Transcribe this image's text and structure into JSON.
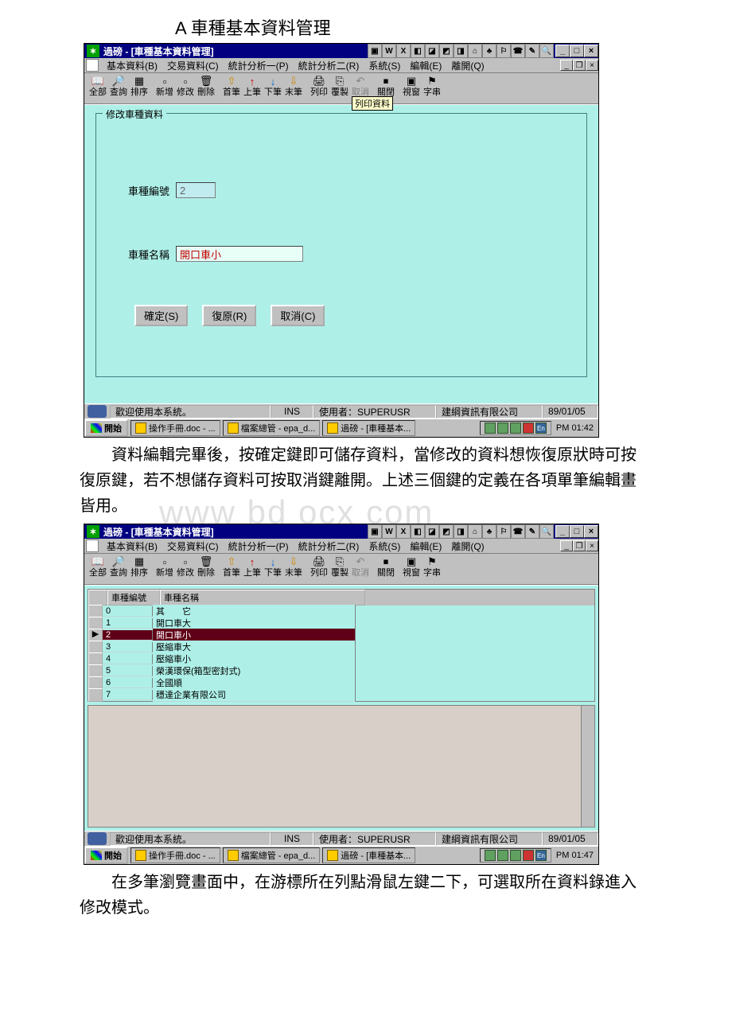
{
  "doc": {
    "heading": "A 車種基本資料管理",
    "watermark": "www  bd ocx  com",
    "para1": "資料編輯完畢後，按確定鍵即可儲存資料，當修改的資料想恢復原狀時可按復原鍵，若不想儲存資料可按取消鍵離開。上述三個鍵的定義在各項單筆編輯畫皆用。",
    "para2": "在多筆瀏覽畫面中，在游標所在列點滑鼠左鍵二下，可選取所在資料錄進入修改模式。"
  },
  "win1": {
    "title": "過磅 - [車種基本資料管理]",
    "menu": {
      "m1": "基本資料(B)",
      "m2": "交易資料(C)",
      "m3": "統計分析一(P)",
      "m4": "統計分析二(R)",
      "m5": "系統(S)",
      "m6": "編輯(E)",
      "m7": "離開(Q)"
    },
    "tool": {
      "all": "全部",
      "query": "查詢",
      "sort": "排序",
      "add": "新增",
      "mod": "修改",
      "del": "刪除",
      "first": "首筆",
      "prev": "上筆",
      "next": "下筆",
      "last": "末筆",
      "print": "列印",
      "copy": "覆製",
      "undo": "取消",
      "close": "關閉",
      "view": "視窗",
      "str": "字串"
    },
    "tooltip": "列印資料",
    "group_title": "修改車種資料",
    "fields": {
      "id_label": "車種編號",
      "id_value": "2",
      "name_label": "車種名稱",
      "name_value": "開口車小"
    },
    "buttons": {
      "ok": "確定(S)",
      "restore": "復原(R)",
      "cancel": "取消(C)"
    },
    "status": {
      "welcome": "歡迎使用本系統。",
      "ins": "INS",
      "user": "使用者：SUPERUSR",
      "company": "建綱資訊有限公司",
      "date": "89/01/05"
    },
    "taskbar": {
      "start": "開始",
      "t1": "操作手冊.doc - ...",
      "t2": "檔案總管 - epa_d...",
      "t3": "過磅 - [車種基本...",
      "ime": "En",
      "clock": "PM 01:42"
    }
  },
  "win2": {
    "title": "過磅 - [車種基本資料管理]",
    "grid": {
      "col_id": "車種編號",
      "col_name": "車種名稱",
      "rows": [
        {
          "id": "0",
          "name": "其　　它"
        },
        {
          "id": "1",
          "name": "開口車大"
        },
        {
          "id": "2",
          "name": "開口車小"
        },
        {
          "id": "3",
          "name": "壓縮車大"
        },
        {
          "id": "4",
          "name": "壓縮車小"
        },
        {
          "id": "5",
          "name": "榮漢環保(箱型密封式)"
        },
        {
          "id": "6",
          "name": "全國順"
        },
        {
          "id": "7",
          "name": "穩達企業有限公司"
        }
      ],
      "selected_index": 2
    },
    "status": {
      "welcome": "歡迎使用本系統。",
      "ins": "INS",
      "user": "使用者：SUPERUSR",
      "company": "建綱資訊有限公司",
      "date": "89/01/05"
    },
    "taskbar": {
      "start": "開始",
      "t1": "操作手冊.doc - ...",
      "t2": "檔案總管 - epa_d...",
      "t3": "過磅 - [車種基本...",
      "ime": "En",
      "clock": "PM 01:47"
    }
  }
}
